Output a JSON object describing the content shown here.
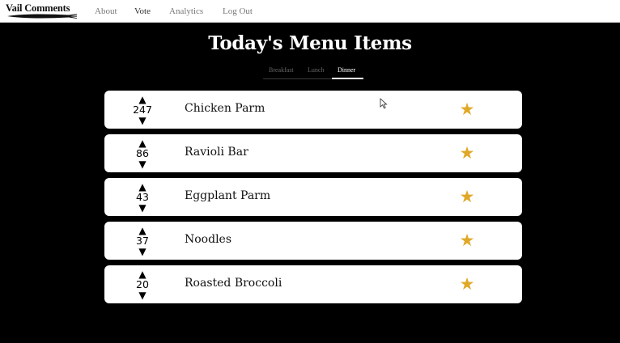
{
  "nav": {
    "logo": "Vail Comments",
    "links": [
      "About",
      "Vote",
      "Analytics",
      "Log Out"
    ],
    "active": "Vote"
  },
  "page": {
    "title": "Today's Menu Items"
  },
  "tabs": {
    "items": [
      "Breakfast",
      "Lunch",
      "Dinner"
    ],
    "active": "Dinner"
  },
  "menu_items": [
    {
      "name": "Chicken Parm",
      "votes": "247"
    },
    {
      "name": "Ravioli Bar",
      "votes": "86"
    },
    {
      "name": "Eggplant Parm",
      "votes": "43"
    },
    {
      "name": "Noodles",
      "votes": "37"
    },
    {
      "name": "Roasted Broccoli",
      "votes": "20"
    }
  ],
  "icons": {
    "upvote": "▲",
    "downvote": "▼",
    "favorite": "★"
  },
  "colors": {
    "star": "#E0A826",
    "background": "#000000",
    "card": "#FFFFFF"
  }
}
